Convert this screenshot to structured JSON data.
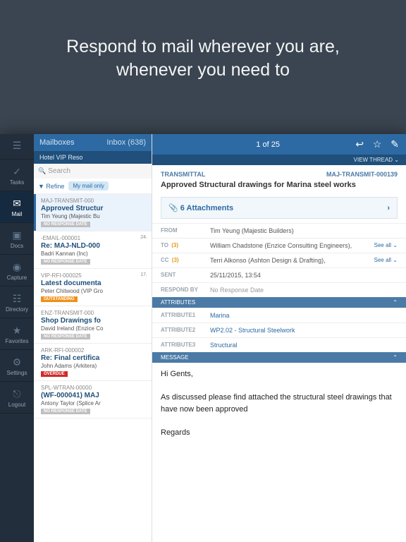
{
  "hero": "Respond to mail wherever you are, whenever you need to",
  "leftbar": {
    "items": [
      {
        "label": "Tasks",
        "glyph": "✓"
      },
      {
        "label": "Mail",
        "glyph": "✉"
      },
      {
        "label": "Docs",
        "glyph": "▣"
      },
      {
        "label": "Capture",
        "glyph": "◉"
      },
      {
        "label": "Directory",
        "glyph": "☷"
      },
      {
        "label": "Favorites",
        "glyph": "★"
      },
      {
        "label": "Settings",
        "glyph": "⚙"
      },
      {
        "label": "Logout",
        "glyph": "⎋"
      }
    ]
  },
  "mailcol": {
    "mailboxes": "Mailboxes",
    "inbox": "Inbox (638)",
    "project": "Hotel VIP Reso",
    "search": "Search",
    "refine": "Refine",
    "pill": "My mail only",
    "msgs": [
      {
        "id": "MAJ-TRANSMIT-000",
        "date": "",
        "subj": "Approved Structur",
        "from": "Tim Yeung (Majestic Bu",
        "badge": "NO RESPONSE DATE",
        "bclass": "b-grey"
      },
      {
        "id": "-EMAIL-000001",
        "date": "24.",
        "subj": "Re: MAJ-NLD-000",
        "from": " Badri Kannan (Inc)",
        "badge": "NO RESPONSE DATE",
        "bclass": "b-grey"
      },
      {
        "id": "VIP-RFI-000025",
        "date": "17.",
        "subj": "Latest documenta",
        "from": "Peter Chitwood (VIP Gro",
        "badge": "OUTSTANDING",
        "bclass": "b-orange"
      },
      {
        "id": "ENZ-TRANSMIT-000",
        "date": "",
        "subj": "Shop Drawings fo",
        "from": "David Ireland (Enzice Co",
        "badge": "NO RESPONSE DATE",
        "bclass": "b-grey"
      },
      {
        "id": "ARK-RFI-000002",
        "date": "",
        "subj": "Re: Final certifica",
        "from": "John Adams (Arkitera)",
        "badge": "OVERDUE",
        "bclass": "b-red"
      },
      {
        "id": "SPL-WTRAN-00000",
        "date": "",
        "subj": "(WF-000041) MAJ",
        "from": "Antony Taylor (Splice Ar",
        "badge": "NO RESPONSE DATE",
        "bclass": "b-grey"
      }
    ]
  },
  "detail": {
    "pos": "1 of 25",
    "viewthread": "VIEW THREAD  ⌄",
    "type": "TRANSMITTAL",
    "ref": "MAJ-TRANSMIT-000139",
    "subject": "Approved Structural drawings for Marina steel works",
    "attachments": "6 Attachments",
    "fields": {
      "from_l": "FROM",
      "from": "Tim Yeung (Majestic Builders)",
      "to_l": "TO",
      "to_n": "(3)",
      "to": "William Chadstone (Enzice Consulting Engineers),",
      "cc_l": "CC",
      "cc_n": "(3)",
      "cc": "Terri Alkonso (Ashton Design & Drafting),",
      "sent_l": "SENT",
      "sent": "25/11/2015, 13:54",
      "resp_l": "RESPOND BY",
      "resp": "No Response Date",
      "seeall": "See all  ⌄"
    },
    "attributes_hdr": "ATTRIBUTES",
    "attrs": [
      {
        "k": "ATTRIBUTE1",
        "v": "Marina"
      },
      {
        "k": "ATTRIBUTE2",
        "v": "WP2.02 - Structural Steelwork"
      },
      {
        "k": "ATTRIBUTE3",
        "v": "Structural"
      }
    ],
    "message_hdr": "MESSAGE",
    "body1": "Hi Gents,",
    "body2": "As discussed please find attached the structural steel drawings that have now been approved",
    "body3": "Regards"
  }
}
